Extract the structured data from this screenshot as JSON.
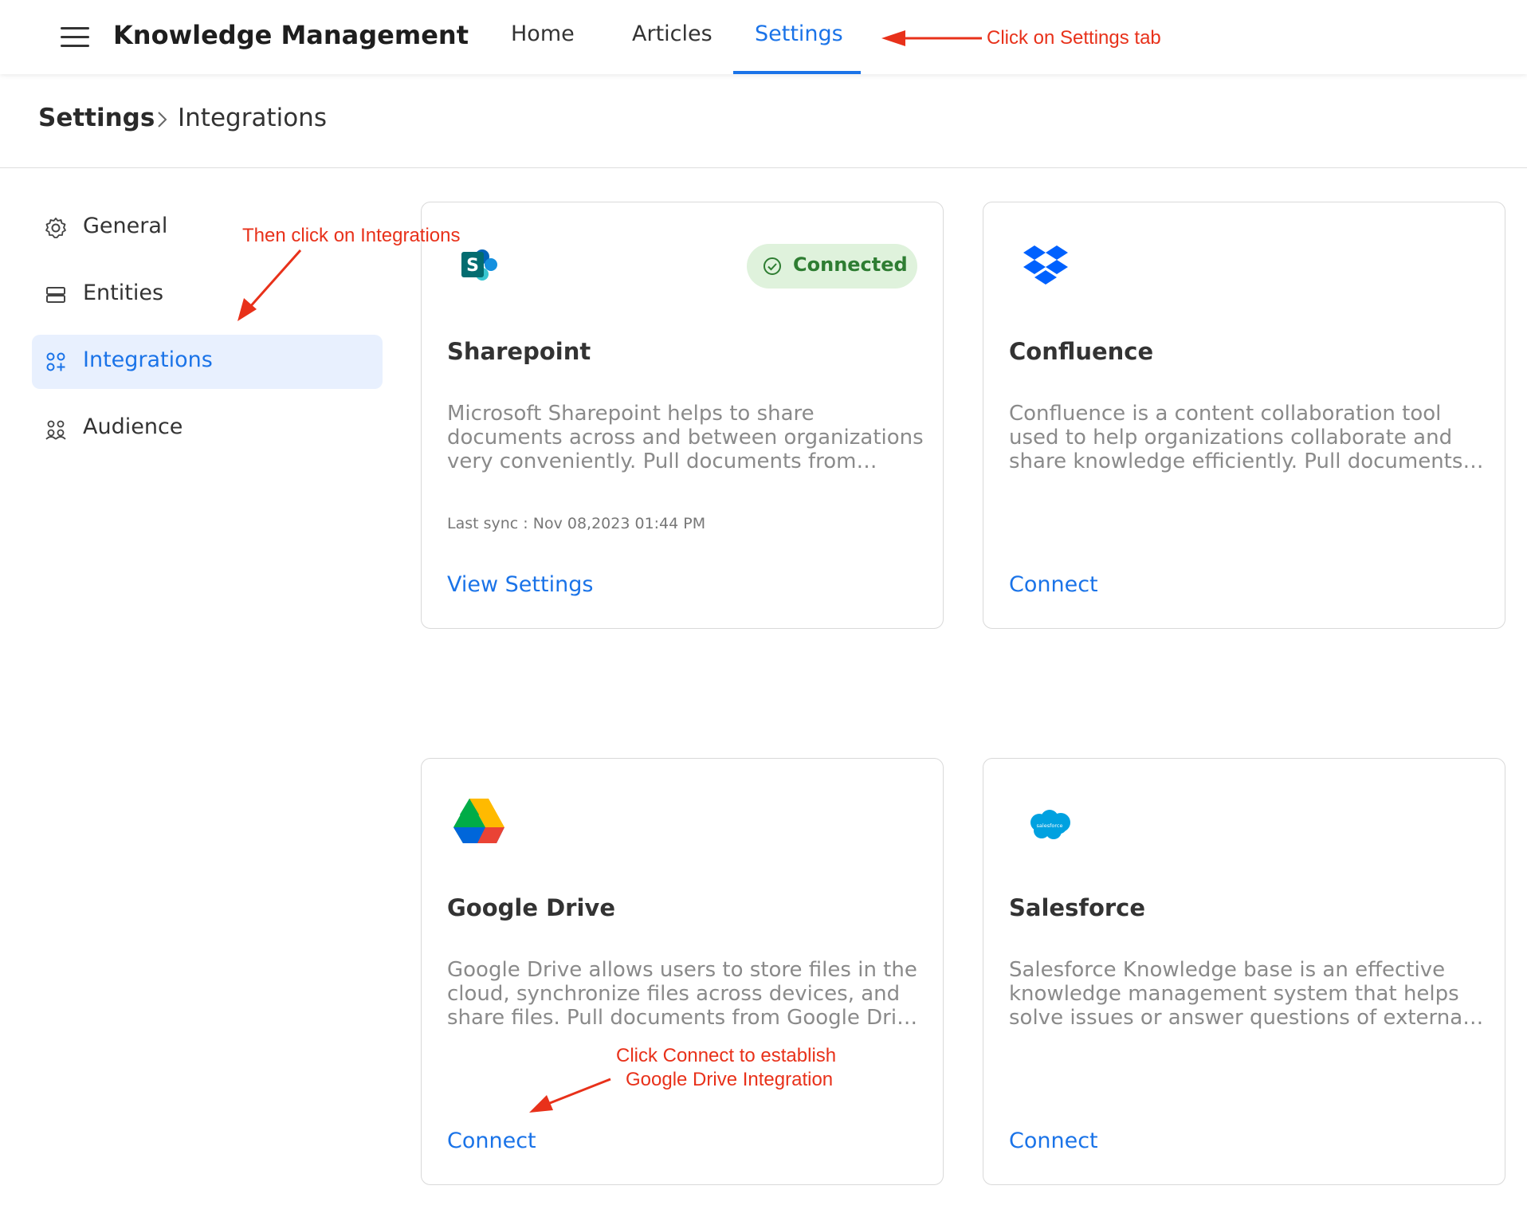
{
  "app": {
    "title": "Knowledge Management"
  },
  "nav": {
    "tabs": [
      {
        "label": "Home"
      },
      {
        "label": "Articles"
      },
      {
        "label": "Settings"
      }
    ]
  },
  "breadcrumb": {
    "root": "Settings",
    "current": "Integrations"
  },
  "sidebar": {
    "items": [
      {
        "label": "General",
        "icon": "gear-icon"
      },
      {
        "label": "Entities",
        "icon": "layers-icon"
      },
      {
        "label": "Integrations",
        "icon": "integrations-icon"
      },
      {
        "label": "Audience",
        "icon": "people-icon"
      }
    ]
  },
  "cards": [
    {
      "title": "Sharepoint",
      "description": "Microsoft Sharepoint helps to share documents across and between organizations very conveniently. Pull documents from Sharepoint to your knowledge base.",
      "status": "Connected",
      "sync_label": "Last sync :",
      "sync_value": "Nov 08,2023 01:44 PM",
      "action": "View Settings",
      "icon": "sharepoint-logo-icon"
    },
    {
      "title": "Confluence",
      "description": "Confluence is a content collaboration tool used to help organizations collaborate and share knowledge efficiently. Pull documents from Confluence to your knowledge base.",
      "action": "Connect",
      "icon": "dropbox-logo-icon"
    },
    {
      "title": "Google Drive",
      "description": "Google Drive allows users to store files in the cloud, synchronize files across devices, and share files. Pull documents from Google Drive to your knowledge base.",
      "action": "Connect",
      "icon": "google-drive-logo-icon"
    },
    {
      "title": "Salesforce",
      "description": "Salesforce Knowledge base is an effective knowledge management system that helps solve issues or answer questions of external customers and internal teams.",
      "action": "Connect",
      "icon": "salesforce-logo-icon",
      "logo_text": "salesforce"
    }
  ],
  "annotations": {
    "settings_tab": "Click on Settings tab",
    "integrations": "Then click on Integrations",
    "connect_line1": "Click Connect to establish",
    "connect_line2": "Google Drive Integration"
  },
  "colors": {
    "accent": "#1a73e8",
    "annotation": "#e8311a",
    "connected_bg": "#dff2dc",
    "connected_text": "#2e7d32"
  }
}
